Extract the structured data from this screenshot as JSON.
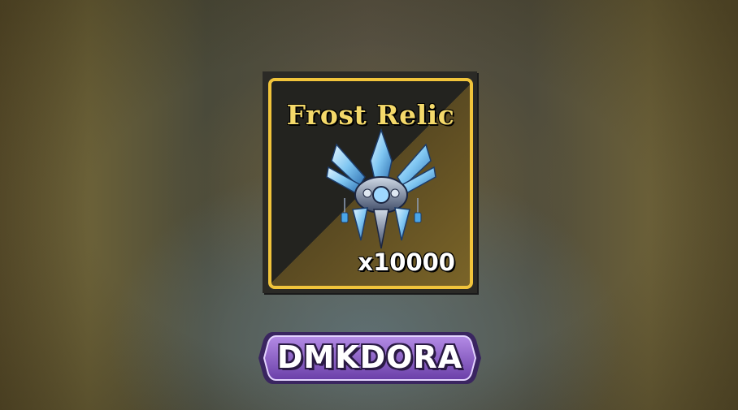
{
  "reward": {
    "item_name": "Frost Relic",
    "quantity": "x10000",
    "icon": "frost-relic-icon",
    "frame_color": "#f1c43b"
  },
  "brand": {
    "name": "DMKDORA",
    "badge_color": "#8a5ac8"
  }
}
